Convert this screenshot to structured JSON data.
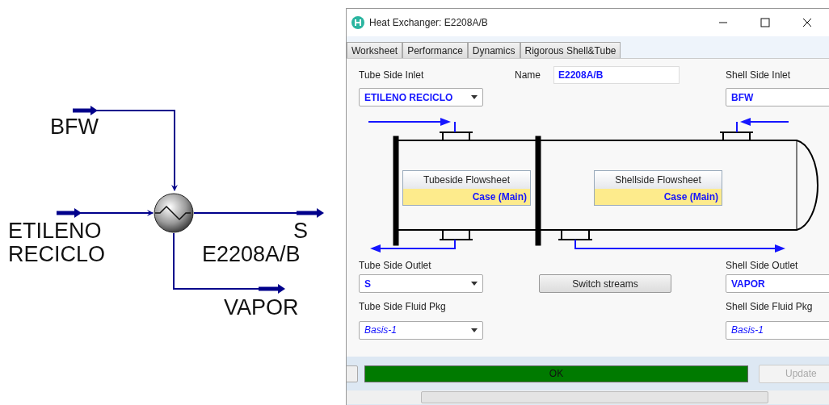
{
  "flowsheet": {
    "unit_label": "E2208A/B",
    "streams": [
      {
        "kind": "in_top",
        "label": "BFW"
      },
      {
        "kind": "in_left",
        "label": "ETILENO\nRECICLO"
      },
      {
        "kind": "out_right",
        "label": "S"
      },
      {
        "kind": "out_bottom",
        "label": "VAPOR"
      }
    ]
  },
  "window": {
    "title": "Heat Exchanger: E2208A/B",
    "tabs": [
      {
        "label": "Worksheet",
        "selected": false
      },
      {
        "label": "Performance",
        "selected": false
      },
      {
        "label": "Dynamics",
        "selected": false
      },
      {
        "label": "Rigorous Shell&Tube",
        "selected": false
      }
    ],
    "tube_side_inlet": {
      "label": "Tube Side Inlet",
      "value": "ETILENO RECICLO"
    },
    "name": {
      "label": "Name",
      "value": "E2208A/B"
    },
    "shell_side_inlet": {
      "label": "Shell Side Inlet",
      "value": "BFW"
    },
    "tubeside_flowsheet": {
      "title": "Tubeside Flowsheet",
      "case": "Case (Main)"
    },
    "shellside_flowsheet": {
      "title": "Shellside Flowsheet",
      "case": "Case (Main)"
    },
    "tube_side_outlet": {
      "label": "Tube Side Outlet",
      "value": "S"
    },
    "switch_button": "Switch streams",
    "shell_side_outlet": {
      "label": "Shell Side Outlet",
      "value": "VAPOR"
    },
    "tube_side_fluid_pkg": {
      "label": "Tube Side Fluid Pkg",
      "value": "Basis-1"
    },
    "shell_side_fluid_pkg": {
      "label": "Shell Side Fluid Pkg",
      "value": "Basis-1"
    },
    "status": "OK",
    "update_button": {
      "label": "Update",
      "disabled": true
    }
  }
}
